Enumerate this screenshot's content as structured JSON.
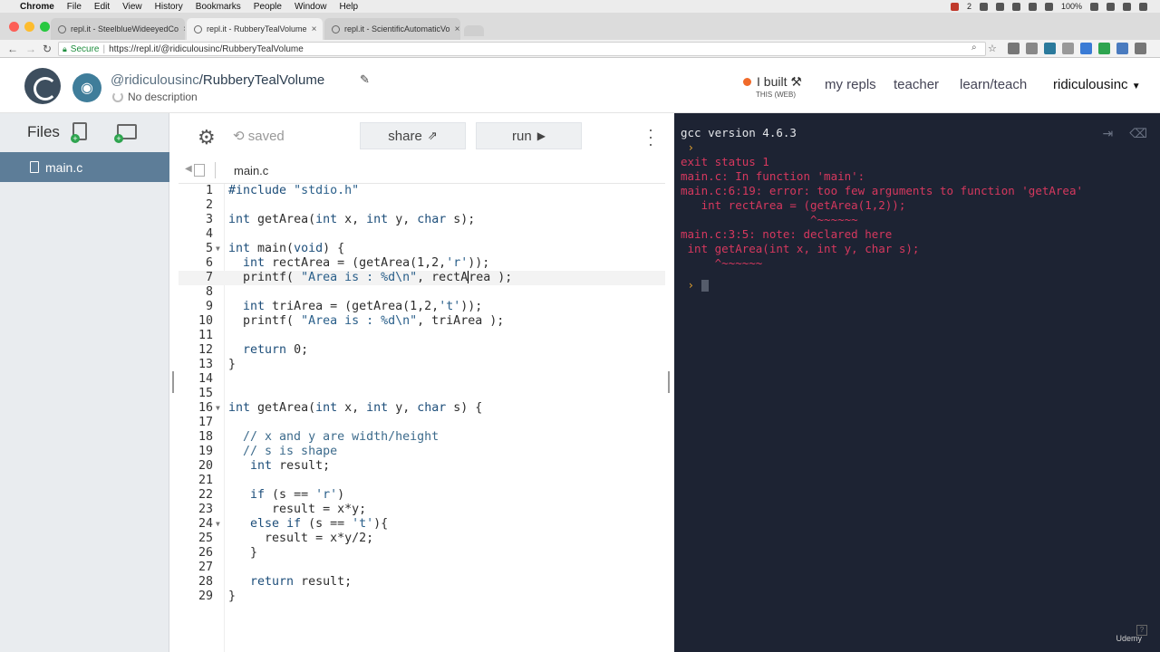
{
  "mac_menu": {
    "app": "Chrome",
    "items": [
      "File",
      "Edit",
      "View",
      "History",
      "Bookmarks",
      "People",
      "Window",
      "Help"
    ],
    "status_badge": "2",
    "battery": "100%"
  },
  "browser": {
    "tabs": [
      {
        "label": "repl.it - SteelblueWideeyedCo",
        "active": false
      },
      {
        "label": "repl.it - RubberyTealVolume",
        "active": true
      },
      {
        "label": "repl.it - ScientificAutomaticVo",
        "active": false
      }
    ],
    "secure_label": "Secure",
    "url": "https://repl.it/@ridiculousinc/RubberyTealVolume"
  },
  "header": {
    "owner": "@ridiculousinc",
    "repl_name": "/RubberyTealVolume",
    "description": "No description",
    "ibuilt_label": "I built",
    "ibuilt_sub": "THIS (WEB)",
    "nav": [
      "my repls",
      "teacher",
      "learn/teach"
    ],
    "user": "ridiculousinc"
  },
  "files_panel": {
    "title": "Files",
    "files": [
      "main.c"
    ]
  },
  "editor": {
    "saved_label": "saved",
    "share_label": "share",
    "run_label": "run",
    "tab_name": "main.c",
    "current_line": 7,
    "lines": [
      "#include \"stdio.h\"",
      "",
      "int getArea(int x, int y, char s);",
      "",
      "int main(void) {",
      "  int rectArea = (getArea(1,2,'r'));",
      "  printf( \"Area is : %d\\n\", rectArea );",
      "",
      "  int triArea = (getArea(1,2,'t'));",
      "  printf( \"Area is : %d\\n\", triArea );",
      "",
      "  return 0;",
      "}",
      "",
      "",
      "int getArea(int x, int y, char s) {",
      "",
      "  // x and y are width/height",
      "  // s is shape",
      "   int result;",
      "",
      "   if (s == 'r')",
      "      result = x*y;",
      "   else if (s == 't'){",
      "     result = x*y/2;",
      "   }",
      "",
      "   return result;",
      "}"
    ],
    "fold_lines": [
      5,
      16,
      24
    ]
  },
  "console": {
    "lines": [
      {
        "text": "gcc version 4.6.3",
        "style": "white"
      },
      {
        "text": " ›",
        "style": "yellow"
      },
      {
        "text": "exit status 1",
        "style": "red"
      },
      {
        "text": "main.c: In function 'main':",
        "style": "red"
      },
      {
        "text": "main.c:6:19: error: too few arguments to function 'getArea'",
        "style": "red"
      },
      {
        "text": "   int rectArea = (getArea(1,2));",
        "style": "red"
      },
      {
        "text": "                   ^~~~~~~",
        "style": "red"
      },
      {
        "text": "main.c:3:5: note: declared here",
        "style": "red"
      },
      {
        "text": " int getArea(int x, int y, char s);",
        "style": "red"
      },
      {
        "text": "     ^~~~~~~",
        "style": "red"
      }
    ],
    "prompt": " ›"
  },
  "watermark": "Udemy"
}
